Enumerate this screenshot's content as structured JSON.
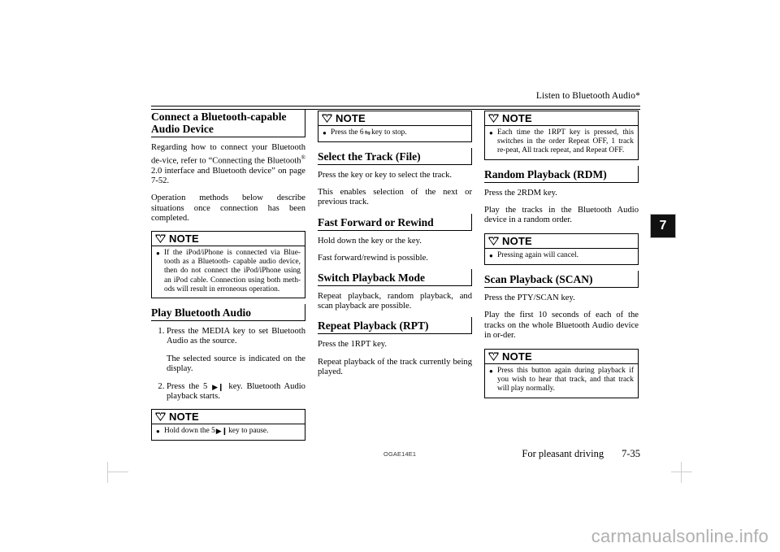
{
  "header": {
    "running_title": "Listen to Bluetooth Audio*"
  },
  "chapter_tab": {
    "number": "7"
  },
  "footer": {
    "doc_code": "OGAE14E1",
    "section_title": "For pleasant driving",
    "page_number": "7-35"
  },
  "watermark": {
    "text": "carmanualsonline.info"
  },
  "note_label": "NOTE",
  "bullet": "●",
  "columns": {
    "left": {
      "heading_connect": "Connect a Bluetooth-capable Audio Device",
      "para_regarding_1": "Regarding how to connect your Bluetooth de-vice, refer to “Connecting the Bluetooth",
      "para_regarding_sup": "®",
      "para_regarding_2": " 2.0 interface and Bluetooth device” on page 7-52.",
      "para_operation": "Operation methods below describe situations once connection has been completed.",
      "note_ipod": "If the iPod/iPhone is connected via Blue-tooth as a Bluetooth- capable audio device, then do not connect the iPod/iPhone using an iPod cable. Connection using both meth-ods will result in erroneous operation.",
      "heading_play": "Play Bluetooth Audio",
      "step1": "Press the MEDIA key to set Bluetooth Audio as the source.",
      "step1_note": "The selected source is indicated on the display.",
      "step2_pre": "Press the 5",
      "step2_glyph": "▶❙",
      "step2_post": "key. Bluetooth Audio playback starts.",
      "note_pause_pre": "Hold down the 5",
      "note_pause_glyph": "▶❙",
      "note_pause_post": "key to pause."
    },
    "middle": {
      "note_stop_pre": "Press the 6",
      "note_stop_glyph": "⇋",
      "note_stop_post": "key to stop.",
      "heading_select_track": "Select the Track (File)",
      "para_press_key": "Press the key or key to select the track.",
      "para_enables": "This enables selection of the next or previous track.",
      "heading_fast_forward": "Fast Forward or Rewind",
      "para_hold_down": "Hold down the key or the key.",
      "para_fast_forward": "Fast forward/rewind is possible.",
      "heading_switch_mode": "Switch Playback Mode",
      "para_repeat_random": "Repeat playback, random playback, and scan playback are possible.",
      "heading_repeat": "Repeat Playback (RPT)",
      "para_press_1rpt": "Press the 1RPT key.",
      "para_repeat_track": "Repeat playback of the track currently being played."
    },
    "right": {
      "note_each_time": "Each time the 1RPT key is pressed, this switches in the order Repeat OFF, 1 track re-peat, All track repeat, and Repeat OFF.",
      "heading_random": "Random Playback (RDM)",
      "para_press_2rdm": "Press the 2RDM key.",
      "para_play_random": "Play the tracks in the Bluetooth Audio device in a random order.",
      "note_pressing_again": "Pressing again will cancel.",
      "heading_scan": "Scan Playback (SCAN)",
      "para_press_pty": "Press the PTY/SCAN key.",
      "para_play_first_10": "Play the first 10 seconds of each of the tracks on the whole Bluetooth Audio device in or-der.",
      "note_press_button": "Press this button again during playback if you wish to hear that track, and that track will play normally."
    }
  }
}
